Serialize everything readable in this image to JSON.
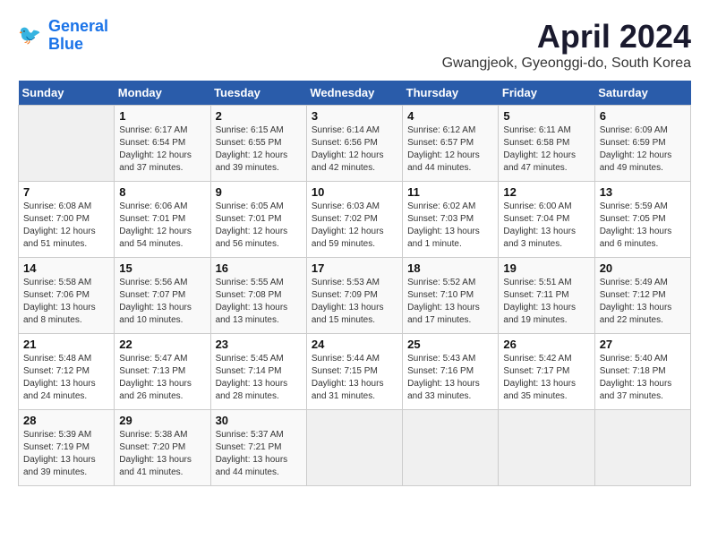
{
  "header": {
    "logo_line1": "General",
    "logo_line2": "Blue",
    "title": "April 2024",
    "subtitle": "Gwangjeok, Gyeonggi-do, South Korea"
  },
  "days_of_week": [
    "Sunday",
    "Monday",
    "Tuesday",
    "Wednesday",
    "Thursday",
    "Friday",
    "Saturday"
  ],
  "weeks": [
    [
      {
        "day": "",
        "info": ""
      },
      {
        "day": "1",
        "info": "Sunrise: 6:17 AM\nSunset: 6:54 PM\nDaylight: 12 hours\nand 37 minutes."
      },
      {
        "day": "2",
        "info": "Sunrise: 6:15 AM\nSunset: 6:55 PM\nDaylight: 12 hours\nand 39 minutes."
      },
      {
        "day": "3",
        "info": "Sunrise: 6:14 AM\nSunset: 6:56 PM\nDaylight: 12 hours\nand 42 minutes."
      },
      {
        "day": "4",
        "info": "Sunrise: 6:12 AM\nSunset: 6:57 PM\nDaylight: 12 hours\nand 44 minutes."
      },
      {
        "day": "5",
        "info": "Sunrise: 6:11 AM\nSunset: 6:58 PM\nDaylight: 12 hours\nand 47 minutes."
      },
      {
        "day": "6",
        "info": "Sunrise: 6:09 AM\nSunset: 6:59 PM\nDaylight: 12 hours\nand 49 minutes."
      }
    ],
    [
      {
        "day": "7",
        "info": "Sunrise: 6:08 AM\nSunset: 7:00 PM\nDaylight: 12 hours\nand 51 minutes."
      },
      {
        "day": "8",
        "info": "Sunrise: 6:06 AM\nSunset: 7:01 PM\nDaylight: 12 hours\nand 54 minutes."
      },
      {
        "day": "9",
        "info": "Sunrise: 6:05 AM\nSunset: 7:01 PM\nDaylight: 12 hours\nand 56 minutes."
      },
      {
        "day": "10",
        "info": "Sunrise: 6:03 AM\nSunset: 7:02 PM\nDaylight: 12 hours\nand 59 minutes."
      },
      {
        "day": "11",
        "info": "Sunrise: 6:02 AM\nSunset: 7:03 PM\nDaylight: 13 hours\nand 1 minute."
      },
      {
        "day": "12",
        "info": "Sunrise: 6:00 AM\nSunset: 7:04 PM\nDaylight: 13 hours\nand 3 minutes."
      },
      {
        "day": "13",
        "info": "Sunrise: 5:59 AM\nSunset: 7:05 PM\nDaylight: 13 hours\nand 6 minutes."
      }
    ],
    [
      {
        "day": "14",
        "info": "Sunrise: 5:58 AM\nSunset: 7:06 PM\nDaylight: 13 hours\nand 8 minutes."
      },
      {
        "day": "15",
        "info": "Sunrise: 5:56 AM\nSunset: 7:07 PM\nDaylight: 13 hours\nand 10 minutes."
      },
      {
        "day": "16",
        "info": "Sunrise: 5:55 AM\nSunset: 7:08 PM\nDaylight: 13 hours\nand 13 minutes."
      },
      {
        "day": "17",
        "info": "Sunrise: 5:53 AM\nSunset: 7:09 PM\nDaylight: 13 hours\nand 15 minutes."
      },
      {
        "day": "18",
        "info": "Sunrise: 5:52 AM\nSunset: 7:10 PM\nDaylight: 13 hours\nand 17 minutes."
      },
      {
        "day": "19",
        "info": "Sunrise: 5:51 AM\nSunset: 7:11 PM\nDaylight: 13 hours\nand 19 minutes."
      },
      {
        "day": "20",
        "info": "Sunrise: 5:49 AM\nSunset: 7:12 PM\nDaylight: 13 hours\nand 22 minutes."
      }
    ],
    [
      {
        "day": "21",
        "info": "Sunrise: 5:48 AM\nSunset: 7:12 PM\nDaylight: 13 hours\nand 24 minutes."
      },
      {
        "day": "22",
        "info": "Sunrise: 5:47 AM\nSunset: 7:13 PM\nDaylight: 13 hours\nand 26 minutes."
      },
      {
        "day": "23",
        "info": "Sunrise: 5:45 AM\nSunset: 7:14 PM\nDaylight: 13 hours\nand 28 minutes."
      },
      {
        "day": "24",
        "info": "Sunrise: 5:44 AM\nSunset: 7:15 PM\nDaylight: 13 hours\nand 31 minutes."
      },
      {
        "day": "25",
        "info": "Sunrise: 5:43 AM\nSunset: 7:16 PM\nDaylight: 13 hours\nand 33 minutes."
      },
      {
        "day": "26",
        "info": "Sunrise: 5:42 AM\nSunset: 7:17 PM\nDaylight: 13 hours\nand 35 minutes."
      },
      {
        "day": "27",
        "info": "Sunrise: 5:40 AM\nSunset: 7:18 PM\nDaylight: 13 hours\nand 37 minutes."
      }
    ],
    [
      {
        "day": "28",
        "info": "Sunrise: 5:39 AM\nSunset: 7:19 PM\nDaylight: 13 hours\nand 39 minutes."
      },
      {
        "day": "29",
        "info": "Sunrise: 5:38 AM\nSunset: 7:20 PM\nDaylight: 13 hours\nand 41 minutes."
      },
      {
        "day": "30",
        "info": "Sunrise: 5:37 AM\nSunset: 7:21 PM\nDaylight: 13 hours\nand 44 minutes."
      },
      {
        "day": "",
        "info": ""
      },
      {
        "day": "",
        "info": ""
      },
      {
        "day": "",
        "info": ""
      },
      {
        "day": "",
        "info": ""
      }
    ]
  ]
}
